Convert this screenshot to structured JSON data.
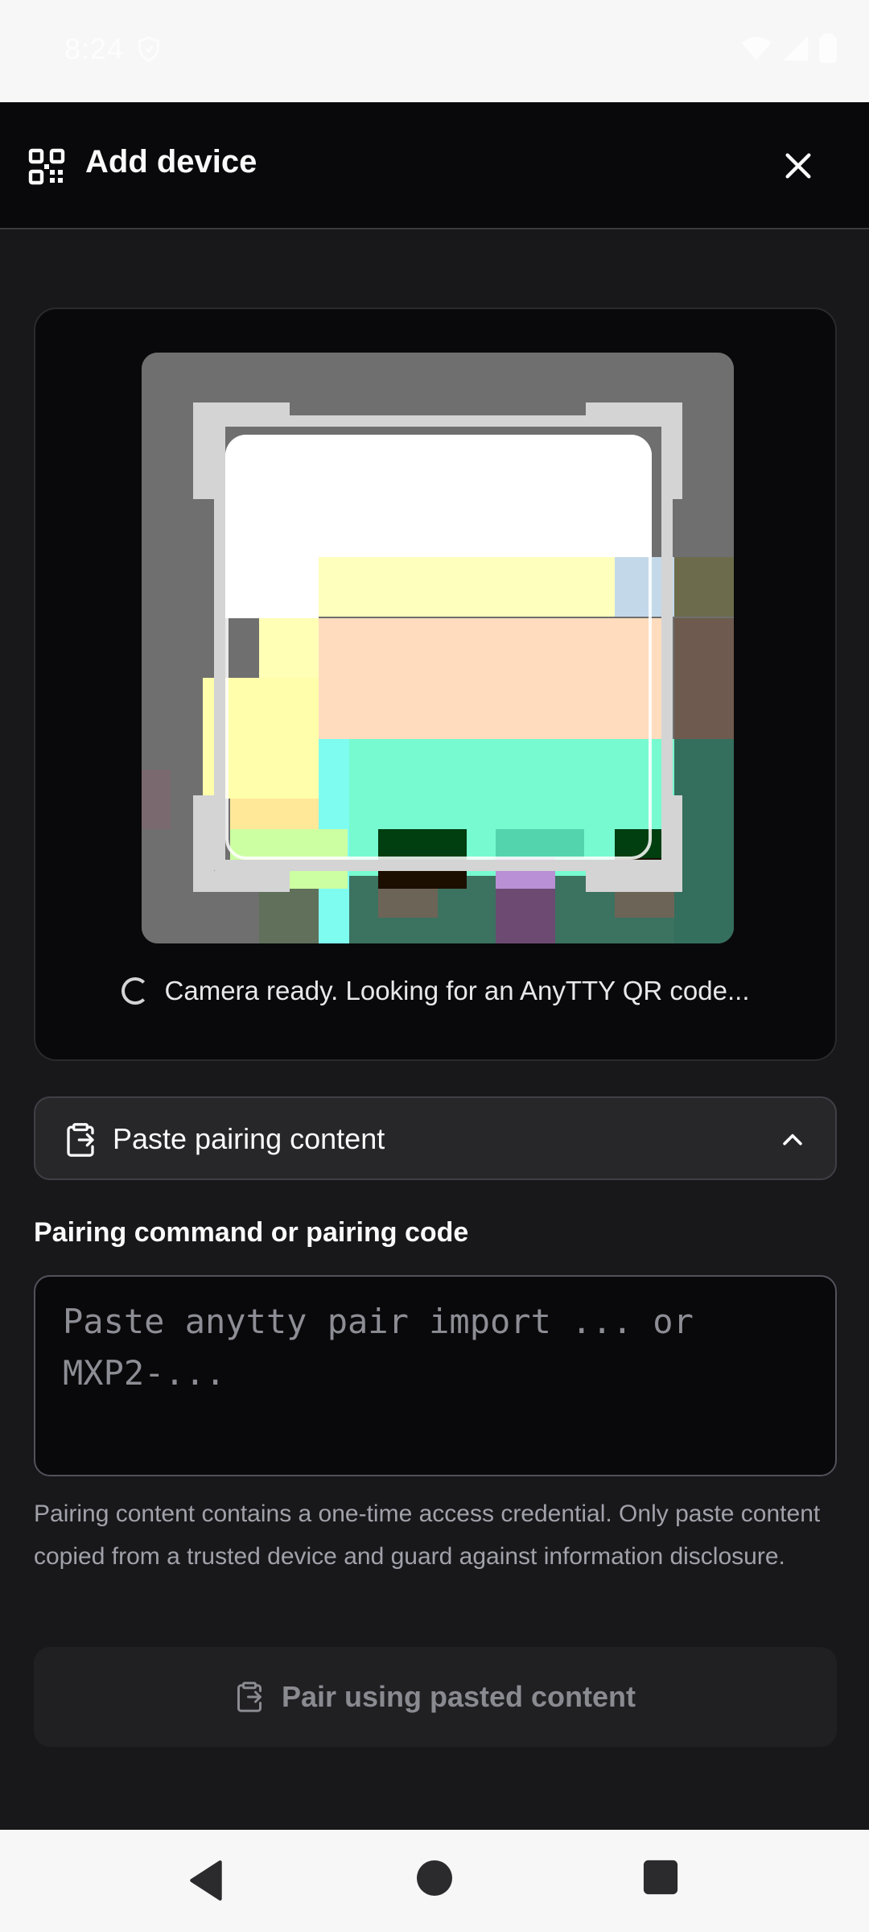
{
  "status_bar": {
    "time": "8:24"
  },
  "app_bar": {
    "title": "Add device"
  },
  "scanner": {
    "status": "Camera ready. Looking for an AnyTTY QR code..."
  },
  "paste_section": {
    "toggle_label": "Paste pairing content",
    "field_label": "Pairing command or pairing code",
    "placeholder_line1": "Paste anytty pair import ... or",
    "placeholder_line2": "MXP2-...",
    "help_text": "Pairing content contains a one-time access credential. Only paste content copied from a trusted device and guard against information disclosure.",
    "button_label": "Pair using pasted content"
  },
  "icons": {
    "app_bar": "qr-code-icon",
    "close": "close-icon",
    "toggle": "clipboard-icon",
    "chevron": "chevron-up-icon",
    "nav": [
      "back-icon",
      "home-icon",
      "recents-icon"
    ]
  },
  "colors": {
    "background": "#18181b",
    "app_bar": "#09090b",
    "card": "#09090b"
  }
}
